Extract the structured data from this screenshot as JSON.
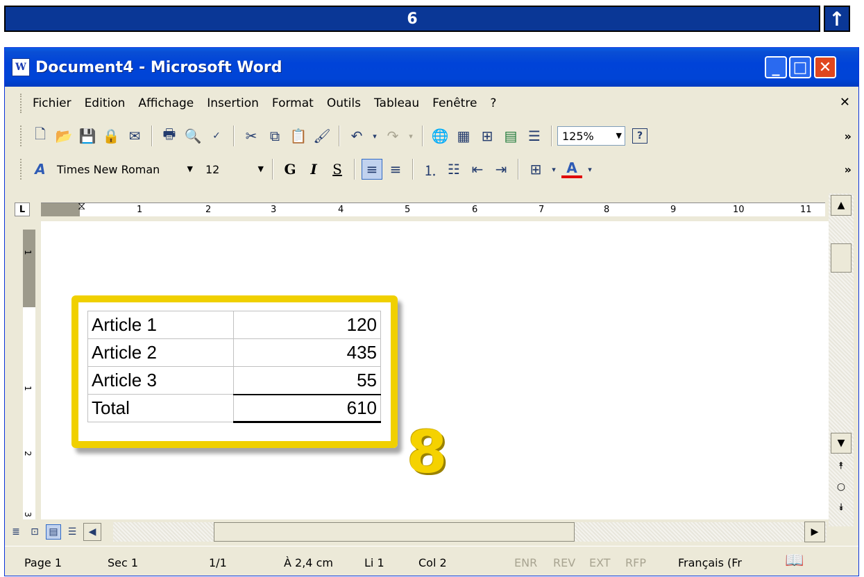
{
  "banner": {
    "step": "6",
    "up_arrow": "↑"
  },
  "window": {
    "title": "Document4 - Microsoft Word",
    "app_icon": "W",
    "minimize": "_",
    "maximize": "□",
    "close": "✕"
  },
  "menu": {
    "items": [
      "Fichier",
      "Edition",
      "Affichage",
      "Insertion",
      "Format",
      "Outils",
      "Tableau",
      "Fenêtre",
      "?"
    ],
    "close_doc": "✕"
  },
  "standard_toolbar": {
    "zoom": "125%",
    "help": "?"
  },
  "format_toolbar": {
    "font": "Times New Roman",
    "size": "12",
    "bold": "G",
    "italic": "I",
    "underline": "S",
    "font_color": "A"
  },
  "ruler": {
    "tab_selector": "L",
    "ticks": [
      "1",
      "2",
      "3",
      "4",
      "5",
      "6",
      "7",
      "8",
      "9",
      "10",
      "11"
    ]
  },
  "vruler": {
    "ticks": [
      "1",
      "1",
      "2",
      "3"
    ]
  },
  "document": {
    "table": [
      {
        "label": "Article 1",
        "value": "120"
      },
      {
        "label": "Article 2",
        "value": "435"
      },
      {
        "label": "Article 3",
        "value": "55"
      },
      {
        "label": "Total",
        "value": "610"
      }
    ],
    "callout_number": "8",
    "highlight_color": "#f0d000"
  },
  "status": {
    "page": "Page 1",
    "section": "Sec 1",
    "pages": "1/1",
    "position": "À 2,4 cm",
    "line": "Li 1",
    "col": "Col 2",
    "enr": "ENR",
    "rev": "REV",
    "ext": "EXT",
    "rfp": "RFP",
    "language": "Français (Fr"
  }
}
